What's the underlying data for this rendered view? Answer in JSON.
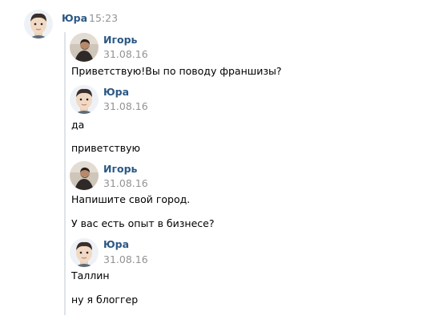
{
  "header": {
    "author": "Юра",
    "time": "15:23",
    "avatar_icon": "cartoon-avatar-icon"
  },
  "forwarded": [
    {
      "author": "Игорь",
      "date": "31.08.16",
      "avatar_icon": "photo-avatar-icon",
      "messages": [
        "Приветствую!Вы по поводу франшизы?"
      ]
    },
    {
      "author": "Юра",
      "date": "31.08.16",
      "avatar_icon": "cartoon-avatar-icon",
      "messages": [
        "да",
        "приветствую"
      ]
    },
    {
      "author": "Игорь",
      "date": "31.08.16",
      "avatar_icon": "photo-avatar-icon",
      "messages": [
        "Напишите свой город.",
        "У вас есть опыт в бизнесе?"
      ]
    },
    {
      "author": "Юра",
      "date": "31.08.16",
      "avatar_icon": "cartoon-avatar-icon",
      "messages": [
        "Таллин",
        "ну я блоггер"
      ]
    }
  ],
  "colors": {
    "link": "#2a5885",
    "meta": "#939393",
    "forward_line": "#dfe3e8"
  }
}
